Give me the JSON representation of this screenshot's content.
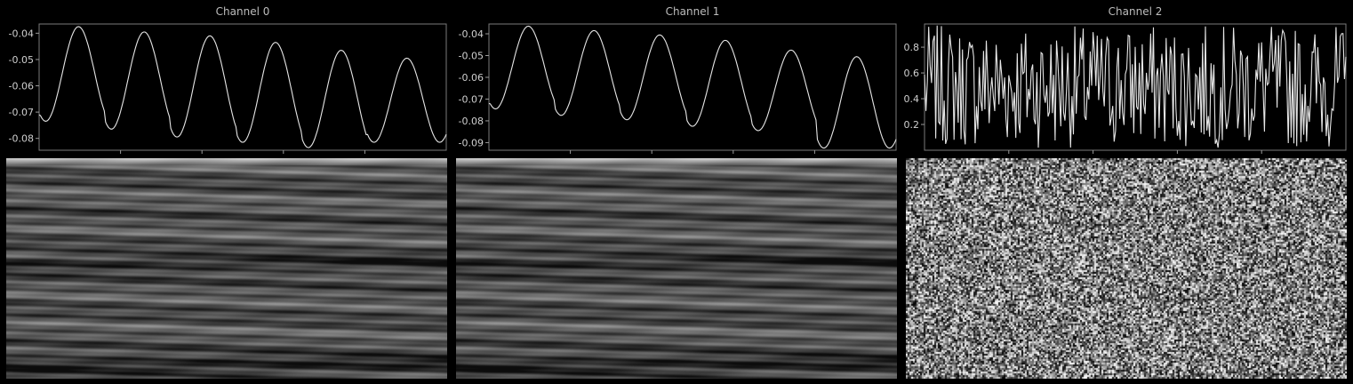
{
  "chart_data": [
    {
      "type": "line",
      "title": "Channel 0",
      "yticks": [
        "-0.04",
        "-0.05",
        "-0.06",
        "-0.07",
        "-0.08"
      ],
      "ylim": [
        -0.0845,
        -0.0365
      ],
      "series": [
        {
          "x_samples": 300,
          "y_start": -0.071,
          "peaks": [
            -0.0375,
            -0.0395,
            -0.041,
            -0.0435,
            -0.0465,
            -0.0495
          ],
          "troughs": [
            -0.0735,
            -0.0765,
            -0.0795,
            -0.0815,
            -0.0835,
            -0.0815
          ]
        }
      ],
      "spectrogram": "banded-gray"
    },
    {
      "type": "line",
      "title": "Channel 1",
      "yticks": [
        "-0.04",
        "-0.05",
        "-0.06",
        "-0.07",
        "-0.08",
        "-0.09"
      ],
      "ylim": [
        -0.0935,
        -0.0355
      ],
      "series": [
        {
          "x_samples": 300,
          "y_start": -0.072,
          "peaks": [
            -0.0365,
            -0.0385,
            -0.0405,
            -0.043,
            -0.0475,
            -0.0505
          ],
          "troughs": [
            -0.0745,
            -0.0775,
            -0.0795,
            -0.0825,
            -0.0845,
            -0.0925
          ]
        }
      ],
      "spectrogram": "banded-gray"
    },
    {
      "type": "line",
      "title": "Channel 2",
      "yticks": [
        "0.8",
        "0.6",
        "0.4",
        "0.2"
      ],
      "ylim": [
        0.0,
        0.98
      ],
      "series": [
        {
          "x_samples": 300,
          "distribution": "uniform-noise",
          "range": [
            0.02,
            0.97
          ]
        }
      ],
      "spectrogram": "noise"
    }
  ]
}
